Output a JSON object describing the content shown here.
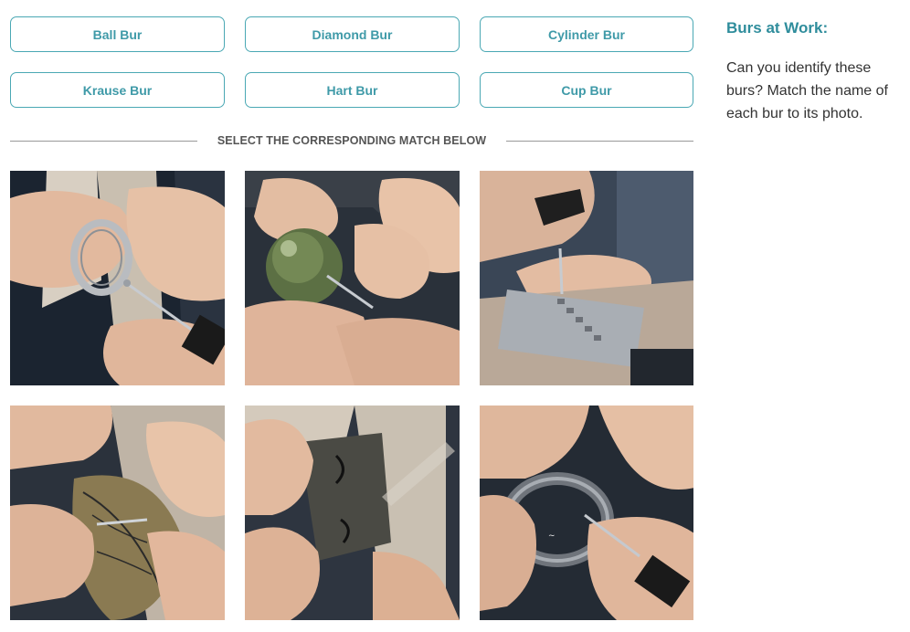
{
  "buttons": [
    {
      "label": "Ball Bur"
    },
    {
      "label": "Diamond Bur"
    },
    {
      "label": "Cylinder Bur"
    },
    {
      "label": "Krause Bur"
    },
    {
      "label": "Hart Bur"
    },
    {
      "label": "Cup Bur"
    }
  ],
  "divider": {
    "text": "SELECT THE CORRESPONDING MATCH BELOW"
  },
  "sidebar": {
    "title": "Burs at Work:",
    "text": "Can you identify these burs? Match the name of each bur to its photo."
  },
  "colors": {
    "accent": "#3f9aa8",
    "title": "#2f8d9c",
    "divider": "#9a9a9a"
  }
}
